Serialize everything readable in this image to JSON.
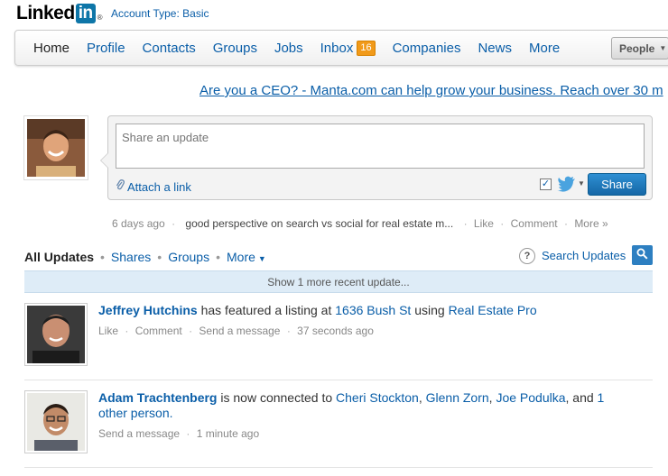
{
  "brand": {
    "logo_text": "Linked",
    "logo_in": "in",
    "reg_mark": "®",
    "account_type": "Account Type: Basic"
  },
  "nav": {
    "items": [
      "Home",
      "Profile",
      "Contacts",
      "Groups",
      "Jobs",
      "Inbox",
      "Companies",
      "News",
      "More"
    ],
    "inbox_count": "16",
    "search_scope": "People"
  },
  "ad": {
    "text": "Are you a CEO? - Manta.com can help grow your business. Reach over 30 m"
  },
  "share": {
    "placeholder": "Share an update",
    "attach_label": "Attach a link",
    "button_label": "Share",
    "twitter_checked": true
  },
  "recent_update": {
    "time": "6 days ago",
    "text": "good perspective on search vs social for real estate m...",
    "actions": [
      "Like",
      "Comment",
      "More »"
    ]
  },
  "filters": {
    "items": [
      "All Updates",
      "Shares",
      "Groups",
      "More"
    ],
    "search_label": "Search Updates",
    "help": "?"
  },
  "more_recent": "Show 1 more recent update...",
  "feed": [
    {
      "name": "Jeffrey Hutchins",
      "text1": " has featured a listing at ",
      "link1": "1636 Bush St",
      "text2": " using ",
      "link2": "Real Estate Pro",
      "actions": [
        "Like",
        "Comment",
        "Send a message",
        "37 seconds ago"
      ]
    },
    {
      "name": "Adam Trachtenberg",
      "text1": " is now connected to ",
      "link1": "Cheri Stockton",
      "sep1": ", ",
      "link2": "Glenn Zorn",
      "sep2": ", ",
      "link3": "Joe Podulka",
      "sep3": ", and ",
      "link4": "1 other person.",
      "actions": [
        "Send a message",
        "1 minute ago"
      ]
    }
  ],
  "colors": {
    "link": "#0a5ea8",
    "brand": "#0e76a8",
    "badge": "#f19a1a",
    "share_button": "#1e78bd",
    "highlight_bar": "#deecf7"
  }
}
